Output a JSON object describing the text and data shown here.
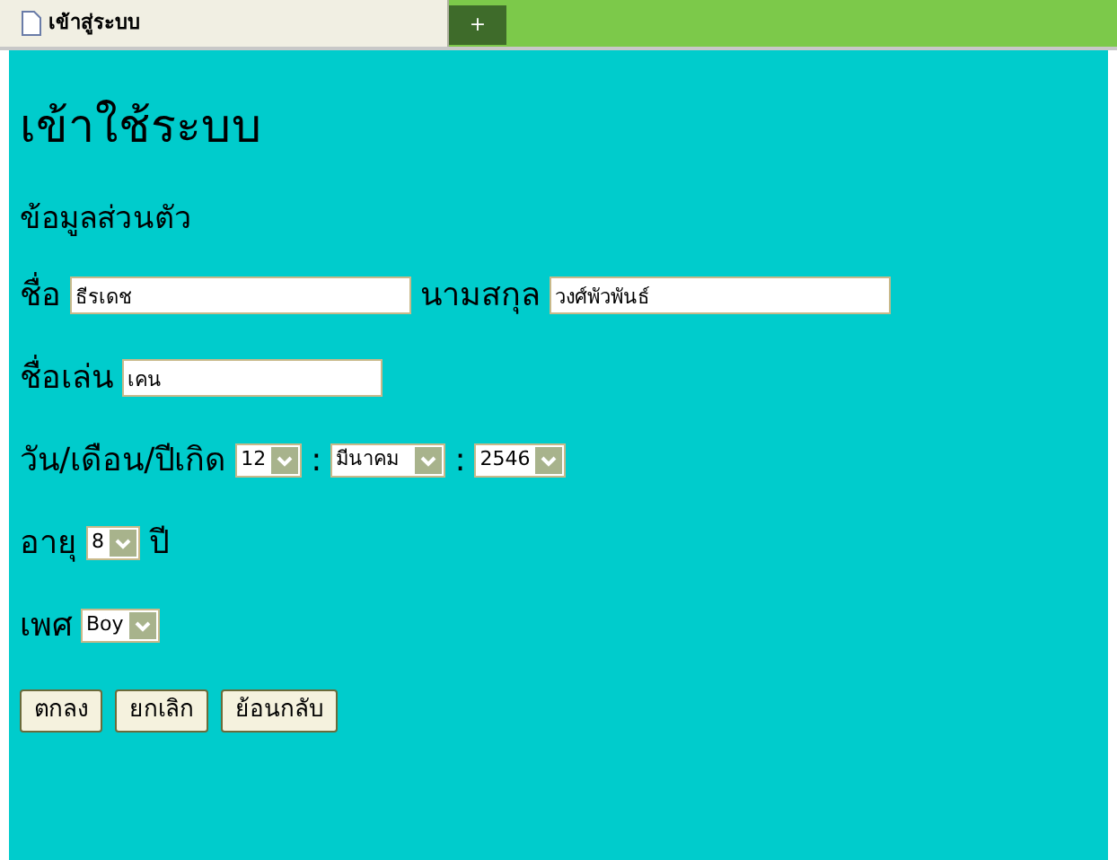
{
  "browser_tab": {
    "title": "เข้าสู่ระบบ"
  },
  "new_tab_button": "+",
  "heading": "เข้าใช้ระบบ",
  "section_title": "ข้อมูลส่วนตัว",
  "rows": [
    {
      "items": [
        {
          "kind": "label",
          "text": "ชื่อ"
        },
        {
          "kind": "input",
          "value": "ธีรเดช"
        },
        {
          "kind": "label",
          "text": "นามสกุล"
        },
        {
          "kind": "input",
          "value": "วงศ์พัวพันธ์"
        }
      ]
    },
    {
      "items": [
        {
          "kind": "label",
          "text": "ชื่อเล่น"
        },
        {
          "kind": "input",
          "value": "เคน"
        }
      ]
    },
    {
      "items": [
        {
          "kind": "label",
          "text": "วัน/เดือน/ปีเกิด"
        },
        {
          "kind": "select",
          "value": "12"
        },
        {
          "kind": "label",
          "text": ":"
        },
        {
          "kind": "select",
          "value": "มีนาคม"
        },
        {
          "kind": "label",
          "text": ":"
        },
        {
          "kind": "select",
          "value": "2546"
        }
      ]
    },
    {
      "items": [
        {
          "kind": "label",
          "text": "อายุ"
        },
        {
          "kind": "select",
          "value": "8"
        },
        {
          "kind": "label",
          "text": "ปี"
        }
      ]
    },
    {
      "items": [
        {
          "kind": "label",
          "text": "เพศ"
        },
        {
          "kind": "select",
          "value": "Boy"
        }
      ]
    }
  ],
  "buttons": [
    "ตกลง",
    "ยกเลิก",
    "ย้อนกลับ"
  ]
}
